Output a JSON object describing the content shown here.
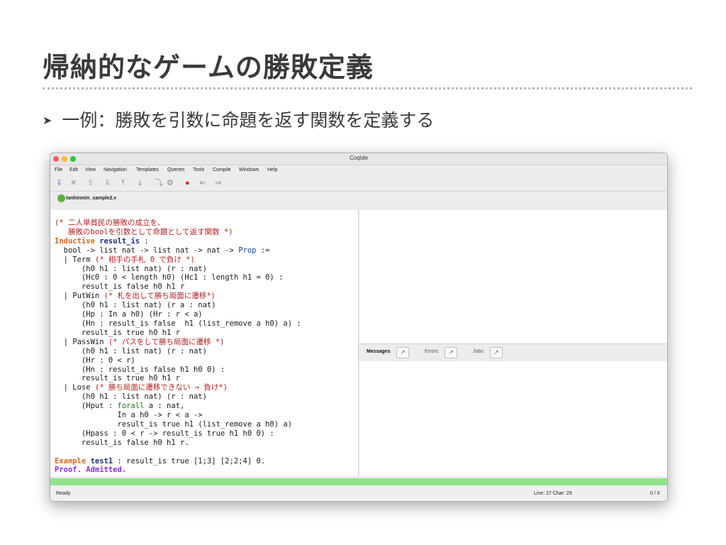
{
  "slide": {
    "title": "帰納的なゲームの勝敗定義",
    "bullet_arrow": "➤",
    "bullet": "一例：勝敗を引数に命題を返す関数を定義する"
  },
  "window": {
    "title": "CoqIde",
    "menu": [
      "File",
      "Edit",
      "View",
      "Navigation",
      "Templates",
      "Queries",
      "Tools",
      "Compile",
      "Windows",
      "Help"
    ],
    "toolbar_icons": [
      "save-icon",
      "close-icon",
      "step-up-icon",
      "step-back-icon",
      "go-top-icon",
      "go-bottom-icon",
      "jump-cursor-icon",
      "interrupt-icon",
      "previous-icon",
      "next-icon"
    ],
    "tab_label": "tanhinmin_sample2.v",
    "pane_tabs": [
      "Messages",
      "Errors",
      "Jobs"
    ],
    "status": {
      "ready": "Ready",
      "line_char": "Line:   27 Char:  29",
      "count": "0 / 0"
    }
  },
  "colors": {
    "keyword": "#d2691e",
    "comment": "#b22222",
    "identifier": "#1c2a7a",
    "proof": "#8a2be2",
    "processed": "#90e48a"
  },
  "code": {
    "l01": "(* 二人単貧民の勝敗の成立を、",
    "l02": "   勝敗のboolを引数として命題として返す関数 *)",
    "l03_kw": "Inductive",
    "l03_id": "result_is",
    "l03_rest": " :",
    "l04_a": "  bool -> list nat -> list nat -> nat -> ",
    "l04_ty": "Prop",
    "l04_b": " :=",
    "l05_a": "  | Term ",
    "l05_c": "(* 相手の手札 0 で負け *)",
    "l06": "      (h0 h1 : list nat) (r : nat)",
    "l07": "      (Hc0 : 0 < length h0) (Hc1 : length h1 = 0) :",
    "l08": "      result_is false h0 h1 r",
    "l09_a": "  | PutWin ",
    "l09_c": "(* 札を出して勝ち局面に遷移*)",
    "l10": "      (h0 h1 : list nat) (r a : nat)",
    "l11": "      (Hp : In a h0) (Hr : r < a)",
    "l12": "      (Hn : result_is false  h1 (list_remove a h0) a) :",
    "l13": "      result_is true h0 h1 r",
    "l14_a": "  | PassWin ",
    "l14_c": "(* パスをして勝ち局面に遷移 *)",
    "l15": "      (h0 h1 : list nat) (r : nat)",
    "l16": "      (Hr : 0 < r)",
    "l17": "      (Hn : result_is false h1 h0 0) :",
    "l18": "      result_is true h0 h1 r",
    "l19_a": "  | Lose ",
    "l19_c": "(* 勝ち局面に遷移できない → 負け*)",
    "l20": "      (h0 h1 : list nat) (r : nat)",
    "l21_a": "      (Hput : ",
    "l21_f": "forall",
    "l21_b": " a : nat,",
    "l22": "              In a h0 -> r < a ->",
    "l23": "              result_is true h1 (list_remove a h0) a)",
    "l24": "      (Hpass : 0 < r -> result_is true h1 h0 0) :",
    "l25": "      result_is false h0 h1 r.",
    "l27_kw": "Example",
    "l27_id": "test1",
    "l27_rest": " : result_is true [1;3] [2;2;4] 0.",
    "l28": "Proof. Admitted."
  }
}
